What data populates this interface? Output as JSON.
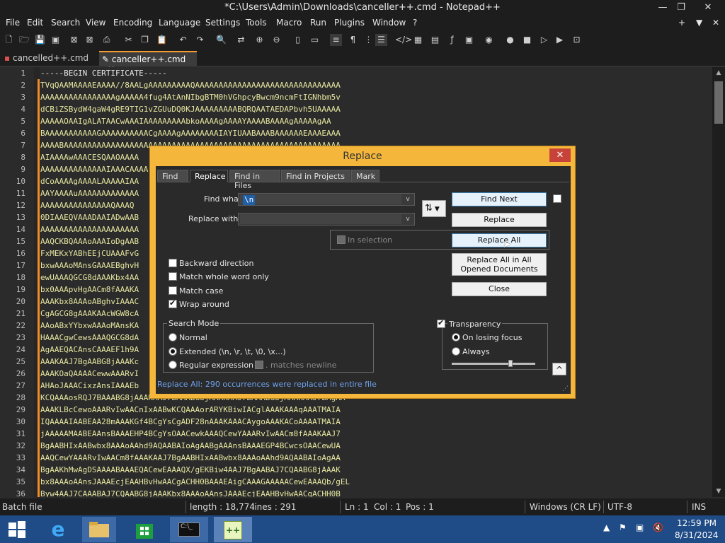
{
  "window": {
    "title": "*C:\\Users\\Admin\\Downloads\\canceller++.cmd - Notepad++",
    "min": "—",
    "max": "❐",
    "close": "✕"
  },
  "menu": [
    "File",
    "Edit",
    "Search",
    "View",
    "Encoding",
    "Language",
    "Settings",
    "Tools",
    "Macro",
    "Run",
    "Plugins",
    "Window",
    "?"
  ],
  "menu_right": {
    "plus": "+",
    "down": "▼",
    "close": "✕"
  },
  "tabs": [
    {
      "label": "cancelled++.cmd",
      "close": "✕"
    },
    {
      "label": "canceller++.cmd",
      "close": "✕"
    }
  ],
  "editor": {
    "line_numbers": [
      "1",
      "2",
      "3",
      "4",
      "5",
      "6",
      "7",
      "8",
      "9",
      "10",
      "11",
      "12",
      "13",
      "14",
      "15",
      "16",
      "17",
      "18",
      "19",
      "20",
      "21",
      "22",
      "23",
      "24",
      "25",
      "26",
      "27",
      "28",
      "29",
      "30",
      "31",
      "32",
      "33",
      "34",
      "35",
      "36"
    ],
    "lines": [
      "-----BEGIN CERTIFICATE-----",
      "TVqQAAMAAAAEAAAA//8AALgAAAAAAAAAQAAAAAAAAAAAAAAAAAAAAAAAAAAAAAAA",
      "AAAAAAAAAAAAAAAAgAAAAA4fug4AtAnNIbgBTM0hVGhpcyBwcm9ncmFtIGNhbm5v",
      "dCBiZSBydW4gaW4gRE9TIG1vZGUuDQ0KJAAAAAAAAABQRQAATAEDAPbvh5UAAAAA",
      "AAAAAOAAIgALATAACwAAAIAAAAAAAAAbkoAAAAgAAAAYAAAABAAAAgAAAAAgAA",
      "BAAAAAAAAAAAGAAAAAAAAAACgAAAAgAAAAAAAAIAYIUAABAAABAAAAAAEAAAEAAA",
      "AAAABAAAAAAAAAAAAAAAAAAAAAAAAAAAAAAAAAAAAAAAAAAAAAAAAAAAAAAAAAAA",
      "AIAAAAwAAACESQAAOAAAA",
      "AAAAAAAAAAAAAAIAAACAAAA",
      "dCoAAAAgAAAALAAAAAIAA",
      "AAYAAAAuAAAAAAAAAAAAA",
      "AAAAAAAAAAAAAAAQAAAQ",
      "0DIAAEQVAAADAAIADwAAB",
      "AAAAAAAAAAAAAAAAAAAAA",
      "AAQCKBQAAAoAAAIoDgAAB",
      "FxMEKxYABhEEjCUAAAFvG",
      "bxwAAAoMAnsGAAAEBghvH",
      "ewUAAAQGCG8dAAAKbx4AA",
      "bx0AAApvHgAACm8fAAAKA",
      "AAAKbx8AAAoABghvIAAAC",
      "CgAGCG8gAAAKAAcWGW8cA",
      "AAoABxYYbxwAAAoMAnsKA",
      "HAAACgwCewsAAAQGCG8dA",
      "AgAAEQACAnsCAAAEF1h9A",
      "AAAKAAJ7BgAABG8jAAAKc",
      "AAAKOaQAAAACewwAAARvI",
      "AHAoJAAACixzAnsIAAAEb",
      "KCQAAAosRQJ7BAAABG8jAAAKAAJ7BAAABG8jAAAKAAJ7BAAABG8jAAAKAAJ7BAgAA",
      "AAAKLBcCewoAAARvIwAACnIxAABwKCQAAAorARYKBiwIACglAAAKAAAqAAATMAIA",
      "IQAAAAIAABEAA28mAAAKGf4BCgYsCgADF28nAAAKAAACAygoAAAKACoAAAATMAIA",
      "jAAAAAMAABEAAnsBAAAEHP4BCgYsOAACewkAAAQCewYAAARvIwAACm8fAAAKAAJ7",
      "BgAABHIxAABwbx8AAAoAAhd9AQAABAIoAgAABgAAAnsBAAAEGP4BCwcsOAACewUA",
      "AAQCewYAAARvIwAACm8fAAAKAAJ7BgAABHIxAABwbx8AAAoAAhd9AQAABAIoAgAA",
      "BgAAKhMwAgDSAAAABAAAEQACewEAAAQX/gEKBiw4AAJ7BgAABAJ7CQAABG8jAAAK",
      "bx8AAAoAAnsJAAAEcjEAAHBvHwAACgACHH0BAAAEAigCAAAGAAAAACewEAAAQb/gEL",
      "Byw4AAJ7CAAABAJ7CQAABG8jAAAKbx8AAAoAAnsJAAAEcjEAAHBvHwAACgACHH0B"
    ]
  },
  "dialog": {
    "title": "Replace",
    "close": "✕",
    "tabs": [
      "Find",
      "Replace",
      "Find in Files",
      "Find in Projects",
      "Mark"
    ],
    "find_what_label": "Find what :",
    "find_what_value": "\\n",
    "replace_with_label": "Replace with :",
    "replace_with_value": "",
    "swap_icon": "⇅",
    "dropdown": "v",
    "in_selection": "In selection",
    "options": [
      {
        "label": "Backward direction",
        "checked": false
      },
      {
        "label": "Match whole word only",
        "checked": false
      },
      {
        "label": "Match case",
        "checked": false
      },
      {
        "label": "Wrap around",
        "checked": true
      }
    ],
    "search_mode_title": "Search Mode",
    "modes": [
      {
        "label": "Normal",
        "selected": false
      },
      {
        "label": "Extended (\\n, \\r, \\t, \\0, \\x...)",
        "selected": true
      },
      {
        "label": "Regular expression",
        "selected": false
      }
    ],
    "matches_newline": ". matches newline",
    "buttons": {
      "find_next": "Find Next",
      "replace": "Replace",
      "replace_all": "Replace All",
      "replace_all_opened": "Replace All in All Opened Documents",
      "close": "Close"
    },
    "transparency_label": "Transparency",
    "transparency_modes": [
      {
        "label": "On losing focus",
        "selected": true
      },
      {
        "label": "Always",
        "selected": false
      }
    ],
    "transparency_level": 0.7,
    "collapse": "^",
    "status_message": "Replace All: 290 occurrences were replaced in entire file"
  },
  "statusbar": {
    "file_type": "Batch file",
    "length": "length : 18,774",
    "lines": "lines : 291",
    "ln": "Ln : 1",
    "col": "Col : 1",
    "pos": "Pos : 1",
    "eol": "Windows (CR LF)",
    "encoding": "UTF-8",
    "mode": "INS"
  },
  "taskbar": {
    "time": "12:59 PM",
    "date": "8/31/2024"
  },
  "colors": {
    "dialog_frame": "#f4b73c",
    "accent_orange": "#f08a24",
    "taskbar": "#1f4b86",
    "status_blue": "#6fa3ef"
  }
}
